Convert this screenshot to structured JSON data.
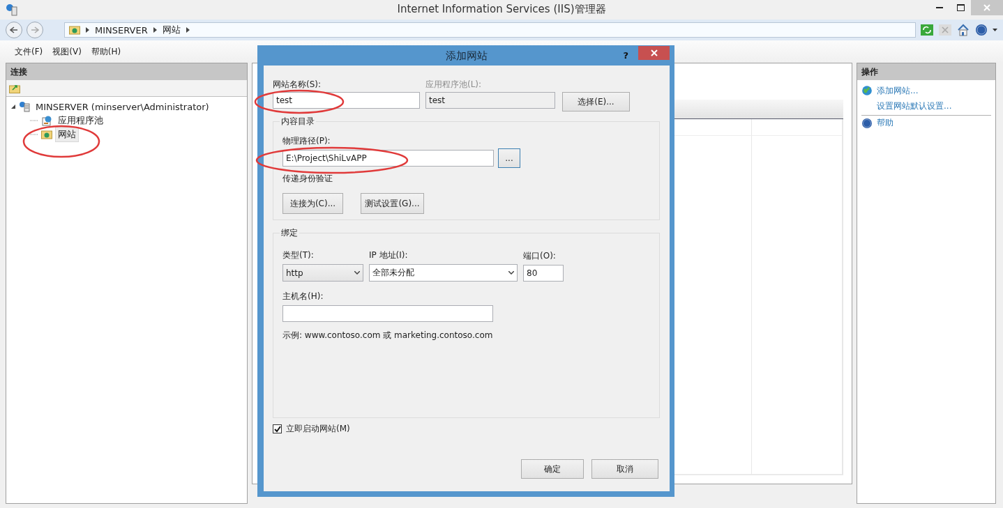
{
  "window": {
    "title": "Internet Information Services (IIS)管理器"
  },
  "address_bar": {
    "breadcrumb": [
      "MINSERVER",
      "网站"
    ]
  },
  "menu": [
    "文件(F)",
    "视图(V)",
    "帮助(H)"
  ],
  "connections": {
    "title": "连接",
    "tree": [
      {
        "label": "MINSERVER (minserver\\Administrator)",
        "kind": "server",
        "expanded": true,
        "selected": false,
        "children": [
          {
            "label": "应用程序池",
            "kind": "pool",
            "selected": false
          },
          {
            "label": "网站",
            "kind": "sites",
            "selected": true
          }
        ]
      }
    ]
  },
  "actions": {
    "title": "操作",
    "items": [
      {
        "label": "添加网站...",
        "kind": "add"
      },
      {
        "label": "设置网站默认设置...",
        "kind": "plain"
      },
      {
        "label": "帮助",
        "kind": "help"
      }
    ]
  },
  "dialog": {
    "title": "添加网站",
    "help": "?",
    "site_name": {
      "label": "网站名称(S):",
      "value": "test"
    },
    "app_pool": {
      "label": "应用程序池(L):",
      "value": "test",
      "disabled": true
    },
    "select_button": "选择(E)...",
    "content_group": {
      "title": "内容目录",
      "path_label": "物理路径(P):",
      "path_value": "E:\\Project\\ShiLvAPP",
      "browse_button": "...",
      "auth_label": "传递身份验证",
      "connect_button": "连接为(C)...",
      "test_button": "测试设置(G)..."
    },
    "binding_group": {
      "title": "绑定",
      "type_label": "类型(T):",
      "type_value": "http",
      "ip_label": "IP 地址(I):",
      "ip_value": "全部未分配",
      "port_label": "端口(O):",
      "port_value": "80",
      "host_label": "主机名(H):",
      "example": "示例: www.contoso.com 或 marketing.contoso.com"
    },
    "start_now": {
      "label": "立即启动网站(M)",
      "checked": true
    },
    "buttons": [
      "确定",
      "取消"
    ]
  }
}
